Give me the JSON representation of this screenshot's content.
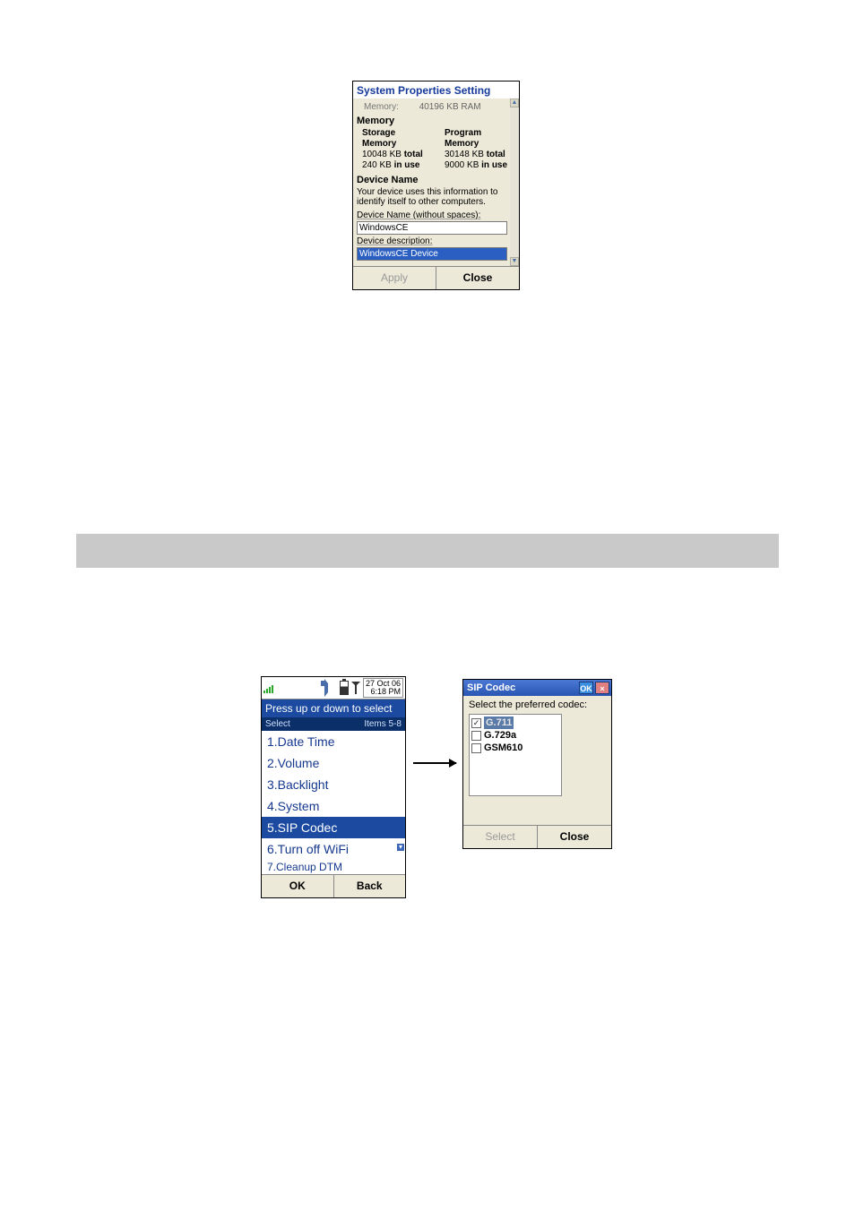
{
  "sys": {
    "title": "System Properties Setting",
    "memory_label": "Memory:",
    "memory_value": "40196 KB RAM",
    "memory_section": "Memory",
    "storage": {
      "h1": "Storage",
      "h2": "Memory",
      "total_val": "10048 KB",
      "total_word": "total",
      "inuse_val": "240 KB",
      "inuse_word": "in use"
    },
    "program": {
      "h1": "Program",
      "h2": "Memory",
      "total_val": "30148 KB",
      "total_word": "total",
      "inuse_val": "9000 KB",
      "inuse_word": "in use"
    },
    "device_name_section": "Device Name",
    "device_name_note": "Your device uses this information to identify itself to other computers.",
    "device_name_label": "Device Name (without spaces):",
    "device_name_value": "WindowsCE",
    "device_desc_label": "Device description:",
    "device_desc_value": "WindowsCE Device",
    "apply": "Apply",
    "close": "Close",
    "scroll_up": "▲",
    "scroll_down": "▼"
  },
  "phone": {
    "date": "27 Oct 06",
    "time": "6:18 PM",
    "instruction": "Press up or down to select",
    "sub_left": "Select",
    "sub_right": "Items 5-8",
    "items": [
      "1.Date Time",
      "2.Volume",
      "3.Backlight",
      "4.System",
      "5.SIP Codec",
      "6.Turn off WiFi"
    ],
    "cut_item": "7.Cleanup DTM",
    "selected_index": 4,
    "ok": "OK",
    "back": "Back",
    "scroll_glyph": "▾"
  },
  "codec": {
    "title": "SIP Codec",
    "ok_btn": "OK",
    "close_x": "×",
    "prompt": "Select the preferred codec:",
    "options": [
      {
        "label": "G.711",
        "checked": true,
        "selected": true
      },
      {
        "label": "G.729a",
        "checked": false,
        "selected": false
      },
      {
        "label": "GSM610",
        "checked": false,
        "selected": false
      }
    ],
    "select": "Select",
    "close": "Close"
  }
}
